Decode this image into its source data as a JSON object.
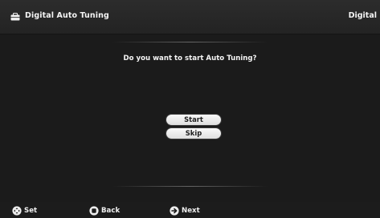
{
  "header": {
    "title": "Digital Auto Tuning",
    "right_label": "Digital",
    "icon": "toolbox-icon"
  },
  "dialog": {
    "question": "Do you want to start Auto Tuning?",
    "buttons": {
      "start": "Start",
      "skip": "Skip"
    }
  },
  "footer": {
    "hints": {
      "set": {
        "label": "Set",
        "icon": "dpad-icon"
      },
      "back": {
        "label": "Back",
        "icon": "back-button-icon"
      },
      "next": {
        "label": "Next",
        "icon": "next-button-icon"
      }
    }
  },
  "colors": {
    "background": "#1b1b1b",
    "header": "#2a2a2a",
    "button": "#f2f2f2",
    "text": "#f4f4f4"
  }
}
